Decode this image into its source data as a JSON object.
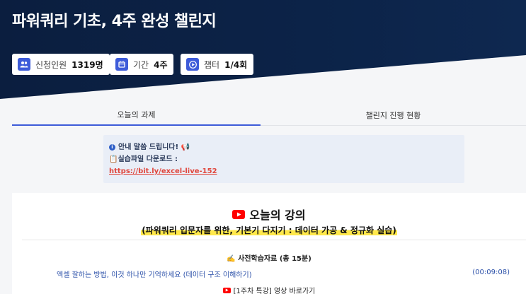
{
  "hero": {
    "title": "파워쿼리 기초, 4주 완성 챌린지",
    "badges": [
      {
        "icon": "people-icon",
        "label": "신청인원",
        "value": "1319명"
      },
      {
        "icon": "calendar-icon",
        "label": "기간",
        "value": "4주"
      },
      {
        "icon": "play-icon",
        "label": "챕터",
        "value": "1/4회"
      }
    ]
  },
  "tabs": [
    {
      "label": "오늘의 과제",
      "active": true
    },
    {
      "label": "챌린지 진행 현황",
      "active": false
    }
  ],
  "notice": {
    "line1": "안내 말씀 드립니다! 📢",
    "line2": "📋실습파일 다운로드 :",
    "link": "https://bit.ly/excel-live-152"
  },
  "lecture": {
    "heading": "오늘의 강의",
    "subtitle": "(파워쿼리 입문자를 위한, 기본기 다지기 : 데이터 가공 & 정규화 실습)",
    "prestudy": "✍️ 사전학습자료 (총 15분)",
    "item_title": "엑셀 잘하는 방법, 이것 하나만 기억하세요 (데이터 구조 이해하기)",
    "item_duration": "(00:09:08)",
    "special": "[1주차 특강] 영상 바로가기"
  },
  "colors": {
    "hero_bg": "#0c2348",
    "accent": "#3d5bd9",
    "link": "#e0463c",
    "highlight": "#ffe84a"
  }
}
